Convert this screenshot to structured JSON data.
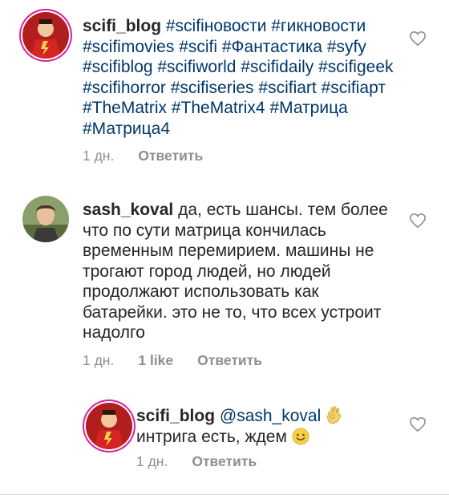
{
  "comments": [
    {
      "username": "scifi_blog",
      "tags": "#sciﬁновости #гикновости #scifimovies #scifi #Фантастика #syfy #scifiblog #scifiworld #scifidaily #scifigeek #scifihorror #sciﬁseries #scifiart #scifiарт #TheMatrix #TheMatrix4 #Матрица #Матрица4",
      "time": "1 дн.",
      "reply": "Ответить"
    },
    {
      "username": "sash_koval",
      "text": "да, есть шансы. тем более что по сути матрица кончилась временным перемирием. машины не трогают город людей, но людей продолжают использовать как батарейки. это не то, что всех устроит надолго",
      "time": "1 дн.",
      "likes": "1 like",
      "reply": "Ответить"
    },
    {
      "username": "scifi_blog",
      "mention": "@sash_koval",
      "text": "интрига есть, ждем",
      "time": "1 дн.",
      "reply": "Ответить"
    }
  ],
  "icons": {
    "like": "heart-outline-icon",
    "ok_hand": "ok-hand-emoji-icon",
    "smile": "smile-emoji-icon"
  },
  "colors": {
    "hashtag": "#00376b",
    "meta": "#8e8e8e",
    "story_ring": "#d6249f"
  }
}
